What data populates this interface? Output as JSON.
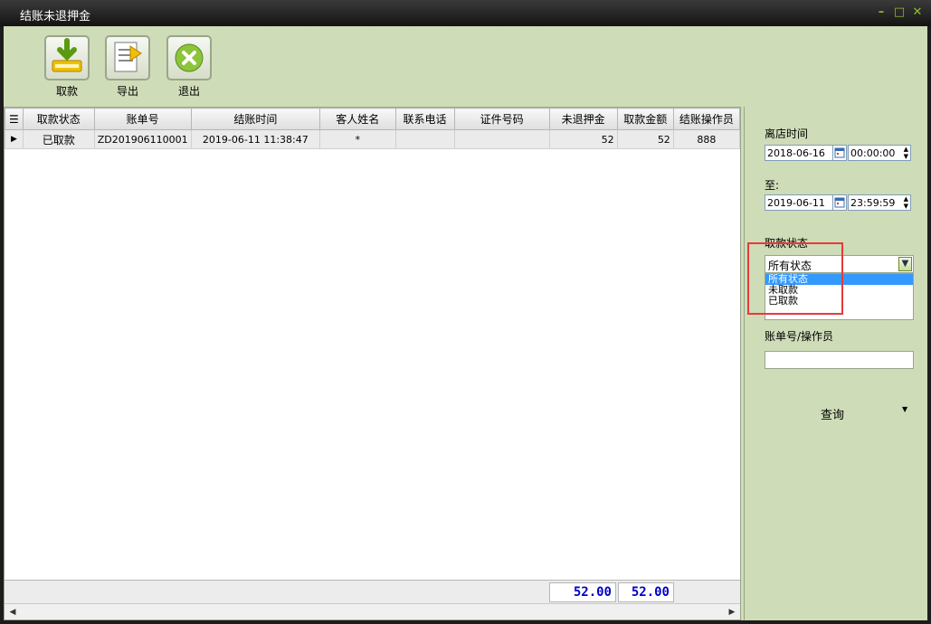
{
  "window": {
    "title": "结账未退押金",
    "min": "–",
    "max": "□",
    "close": "✕"
  },
  "toolbar": {
    "collect_label": "取款",
    "export_label": "导出",
    "exit_label": "退出"
  },
  "grid": {
    "columns": [
      "取款状态",
      "账单号",
      "结账时间",
      "客人姓名",
      "联系电话",
      "证件号码",
      "未退押金",
      "取款金额",
      "结账操作员"
    ],
    "rows": [
      {
        "status": "已取款",
        "bill_no": "ZD201906110001",
        "checkout_time": "2019-06-11 11:38:47",
        "guest_name": "*",
        "phone": "",
        "id_no": "",
        "deposit": "52",
        "amount": "52",
        "operator": "888"
      }
    ],
    "totals": {
      "deposit": "52.00",
      "amount": "52.00"
    }
  },
  "filters": {
    "leave_time_label": "离店时间",
    "from_date": "2018-06-16",
    "from_time": "00:00:00",
    "to_label": "至:",
    "to_date": "2019-06-11",
    "to_time": "23:59:59",
    "status_label": "取款状态",
    "status_value": "所有状态",
    "status_options": [
      "所有状态",
      "未取款",
      "已取款"
    ],
    "bill_operator_label": "账单号/操作员",
    "bill_operator_value": "",
    "query_label": "查询"
  },
  "colors": {
    "panel": "#cfdcb8",
    "accent": "#3399ff",
    "total_text": "#0000c8",
    "highlight": "#e83a3a"
  }
}
